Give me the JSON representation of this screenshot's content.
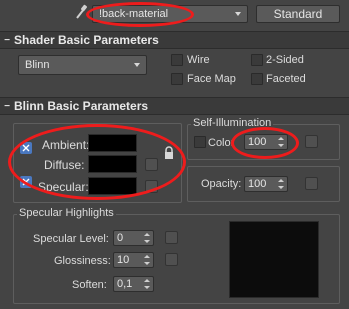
{
  "material_bar": {
    "material_name": "!back-material",
    "material_type_button": "Standard"
  },
  "shader_rollout": {
    "title": "Shader Basic Parameters",
    "toggle": "−",
    "shader_dropdown": "Blinn",
    "checkboxes": {
      "wire": "Wire",
      "two_sided": "2-Sided",
      "face_map": "Face Map",
      "faceted": "Faceted"
    }
  },
  "blinn_rollout": {
    "title": "Blinn Basic Parameters",
    "toggle": "−",
    "color_labels": {
      "ambient": "Ambient:",
      "diffuse": "Diffuse:",
      "specular": "Specular:"
    },
    "self_illumination": {
      "group_title": "Self-Illumination",
      "color_label": "Color",
      "value": "100"
    },
    "opacity": {
      "label": "Opacity:",
      "value": "100"
    },
    "specular_highlights": {
      "group_title": "Specular Highlights",
      "specular_level_label": "Specular Level:",
      "specular_level_value": "0",
      "glossiness_label": "Glossiness:",
      "glossiness_value": "10",
      "soften_label": "Soften:",
      "soften_value": "0,1"
    }
  },
  "colors": {
    "annotation_red": "#ee1c1c",
    "panel_bg": "#444444",
    "swatch": "#000000"
  },
  "icons": [
    "eyedropper-icon",
    "lock-icon",
    "link-icon",
    "chevron-down-icon",
    "spinner-arrows-icon"
  ]
}
